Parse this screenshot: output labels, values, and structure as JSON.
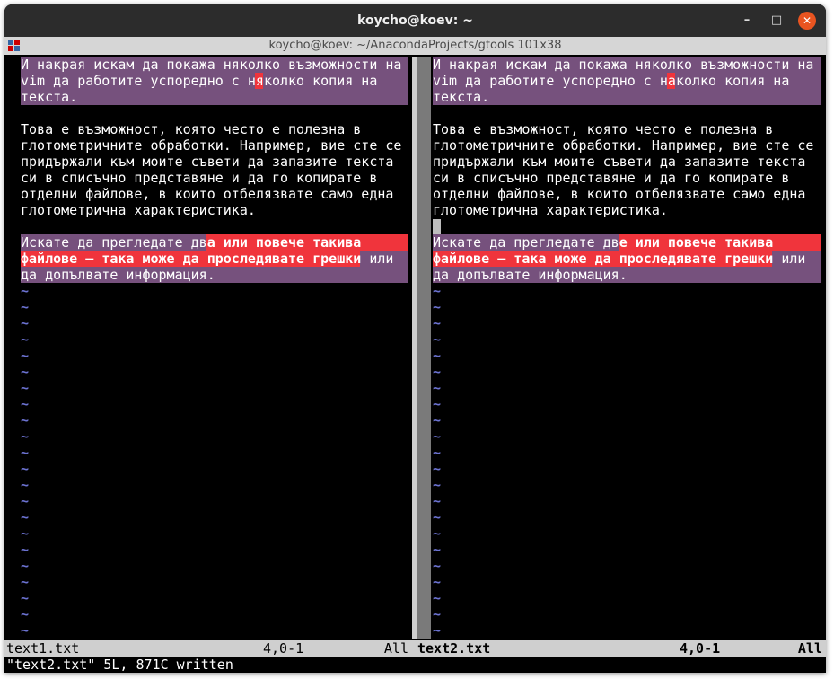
{
  "window": {
    "title": "koycho@koev: ~",
    "subtitle": "koycho@koev: ~/AnacondaProjects/gtools 101x38",
    "buttons": {
      "minimize": "–",
      "maximize": "□",
      "close": "✕"
    }
  },
  "left_pane": {
    "lines": [
      "И накрая искам да покажа няколко възможности на",
      "vim да работите успоредно с н",
      "я",
      "колко копия на",
      "текста.",
      "Това е възможност, която често е полезна в",
      "глотометричните обработки. Например, вие сте се",
      "придържали към моите съвети да запазите текста",
      "си в списъчно представяне и да го копирате в",
      "отделни файлове, в които отбелязвате само една",
      "глотометрична характеристика.",
      "Искате да прегледате дв",
      "а или повече такива",
      "файлове – така може да проследявате грешки",
      " или",
      "да допълвате информация."
    ]
  },
  "right_pane": {
    "lines": [
      "И накрая искам да покажа няколко възможности на",
      "vim да работите успоредно с н",
      "а",
      "колко копия на",
      "текста.",
      "Това е възможност, която често е полезна в",
      "глотометричните обработки. Например, вие сте се",
      "придържали към моите съвети да запазите текста",
      "си в списъчно представяне и да го копирате в",
      "отделни файлове, в които отбелязвате само една",
      "глотометрична характеристика.",
      "Искате да прегледате дв",
      "е или повече такива",
      "файлове – така може да проследявате грешки",
      " или",
      "да допълвате информация."
    ]
  },
  "tilde": "~",
  "status": {
    "left": {
      "file": "text1.txt",
      "position": "4,0-1",
      "scroll": "All"
    },
    "right": {
      "file": "text2.txt",
      "position": "4,0-1",
      "scroll": "All"
    }
  },
  "command_line": "\"text2.txt\" 5L, 871C written",
  "colors": {
    "diff_change": "#76517d",
    "diff_text": "#f0343c",
    "tilde": "#6b72d0",
    "close_button": "#e95420"
  }
}
